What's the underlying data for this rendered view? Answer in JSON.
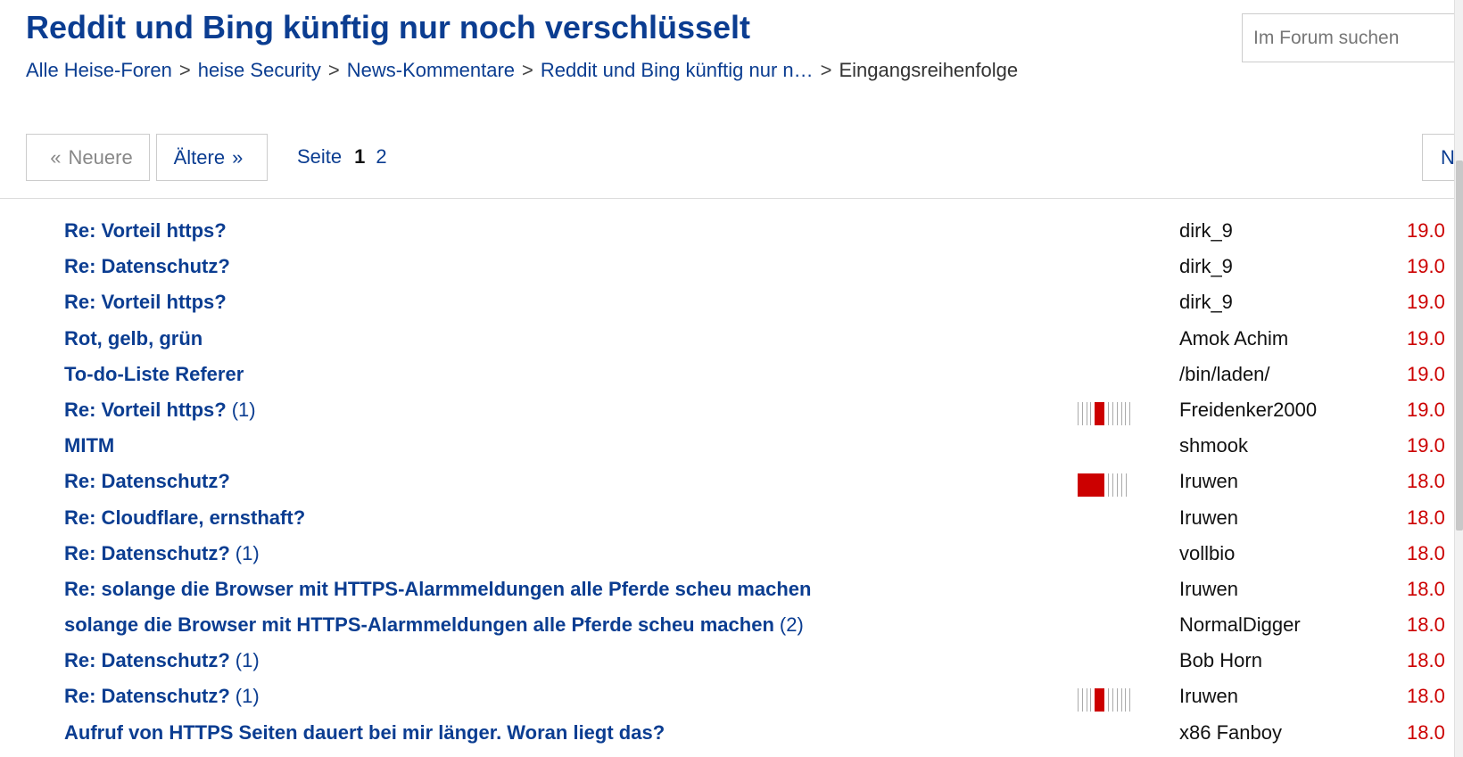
{
  "title": "Reddit und Bing künftig nur noch verschlüsselt",
  "breadcrumb": {
    "items": [
      "Alle Heise-Foren",
      "heise Security",
      "News-Kommentare",
      "Reddit und Bing künftig nur n…"
    ],
    "current": "Eingangsreihenfolge",
    "separator": ">"
  },
  "search": {
    "placeholder": "Im Forum suchen"
  },
  "pager": {
    "newer_label": "Neuere",
    "newer_arrow": "«",
    "older_label": "Ältere",
    "older_arrow": "»",
    "next_label": "N",
    "page_label": "Seite",
    "current_page": "1",
    "other_page": "2"
  },
  "threads": [
    {
      "title": "Re: Vorteil https?",
      "count": "",
      "rating": null,
      "author": "dirk_9",
      "date": "19.0"
    },
    {
      "title": "Re: Datenschutz?",
      "count": "",
      "rating": null,
      "author": "dirk_9",
      "date": "19.0"
    },
    {
      "title": "Re: Vorteil https?",
      "count": "",
      "rating": null,
      "author": "dirk_9",
      "date": "19.0"
    },
    {
      "title": "Rot, gelb, grün",
      "count": "",
      "rating": null,
      "author": "Amok Achim",
      "date": "19.0"
    },
    {
      "title": "To-do-Liste Referer",
      "count": "",
      "rating": null,
      "author": "/bin/laden/",
      "date": "19.0"
    },
    {
      "title": "Re: Vorteil https?",
      "count": "(1)",
      "rating": "mid",
      "author": "Freidenker2000",
      "date": "19.0"
    },
    {
      "title": "MITM",
      "count": "",
      "rating": null,
      "author": "shmook",
      "date": "19.0"
    },
    {
      "title": "Re: Datenschutz?",
      "count": "",
      "rating": "high",
      "author": "Iruwen",
      "date": "18.0"
    },
    {
      "title": "Re: Cloudflare, ernsthaft?",
      "count": "",
      "rating": null,
      "author": "Iruwen",
      "date": "18.0"
    },
    {
      "title": "Re: Datenschutz?",
      "count": "(1)",
      "rating": null,
      "author": "vollbio",
      "date": "18.0"
    },
    {
      "title": "Re: solange die Browser mit HTTPS-Alarmmeldungen alle Pferde scheu machen",
      "count": "",
      "rating": null,
      "author": "Iruwen",
      "date": "18.0"
    },
    {
      "title": "solange die Browser mit HTTPS-Alarmmeldungen alle Pferde scheu machen",
      "count": "(2)",
      "rating": null,
      "author": "NormalDigger",
      "date": "18.0"
    },
    {
      "title": "Re: Datenschutz?",
      "count": "(1)",
      "rating": null,
      "author": "Bob Horn",
      "date": "18.0"
    },
    {
      "title": "Re: Datenschutz?",
      "count": "(1)",
      "rating": "mid",
      "author": "Iruwen",
      "date": "18.0"
    },
    {
      "title": "Aufruf von HTTPS Seiten dauert bei mir länger. Woran liegt das?",
      "count": "",
      "rating": null,
      "author": "x86 Fanboy",
      "date": "18.0"
    }
  ],
  "colors": {
    "link": "#0b3d91",
    "date": "#cc0000",
    "rating_on": "#cc0000",
    "rating_off": "#aaaaaa"
  }
}
